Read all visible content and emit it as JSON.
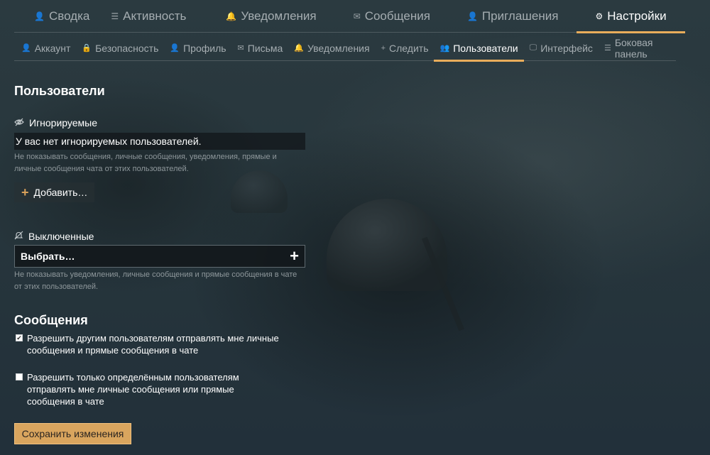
{
  "colors": {
    "accent": "#e9ad5b",
    "button": "#d9a55e",
    "background": "#26353b"
  },
  "top_nav": [
    {
      "label": "Сводка",
      "icon": "user-icon",
      "glyph": "👤"
    },
    {
      "label": "Активность",
      "icon": "list-icon",
      "glyph": "☰"
    },
    {
      "label": "Уведомления",
      "icon": "bell-icon",
      "glyph": "🔔"
    },
    {
      "label": "Сообщения",
      "icon": "envelope-icon",
      "glyph": "✉"
    },
    {
      "label": "Приглашения",
      "icon": "user-plus-icon",
      "glyph": "👤"
    },
    {
      "label": "Настройки",
      "icon": "gear-icon",
      "glyph": "⚙",
      "active": true
    }
  ],
  "sub_nav": [
    {
      "label": "Аккаунт",
      "icon": "user-icon",
      "glyph": "👤"
    },
    {
      "label": "Безопасность",
      "icon": "lock-icon",
      "glyph": "🔒"
    },
    {
      "label": "Профиль",
      "icon": "user-icon",
      "glyph": "👤"
    },
    {
      "label": "Письма",
      "icon": "envelope-icon",
      "glyph": "✉"
    },
    {
      "label": "Уведомления",
      "icon": "bell-icon",
      "glyph": "🔔"
    },
    {
      "label": "Следить",
      "icon": "plus-icon",
      "glyph": "+"
    },
    {
      "label": "Пользователи",
      "icon": "users-icon",
      "glyph": "👥",
      "active": true
    },
    {
      "label": "Интерфейс",
      "icon": "monitor-icon",
      "glyph": "🖵"
    },
    {
      "label": "Боковая панель",
      "icon": "list-icon",
      "glyph": "☰"
    }
  ],
  "page_title": "Пользователи",
  "ignored": {
    "label": "Игнорируемые",
    "icon": "eye-slash-icon",
    "value": "У вас нет игнорируемых пользователей.",
    "help": "Не показывать сообщения, личные сообщения, уведомления, прямые и личные сообщения чата от этих пользователей.",
    "add_label": "Добавить…"
  },
  "muted": {
    "label": "Выключенные",
    "icon": "bell-slash-icon",
    "select_placeholder": "Выбрать…",
    "help": "Не показывать уведомления, личные сообщения и прямые сообщения в чате от этих пользователей."
  },
  "messages": {
    "title": "Сообщения",
    "options": [
      {
        "label": "Разрешить другим пользователям отправлять мне личные сообщения и прямые сообщения в чате",
        "checked": true
      },
      {
        "label": "Разрешить только определённым пользователям отправлять мне личные сообщения или прямые сообщения в чате",
        "checked": false
      }
    ]
  },
  "save_label": "Сохранить изменения"
}
